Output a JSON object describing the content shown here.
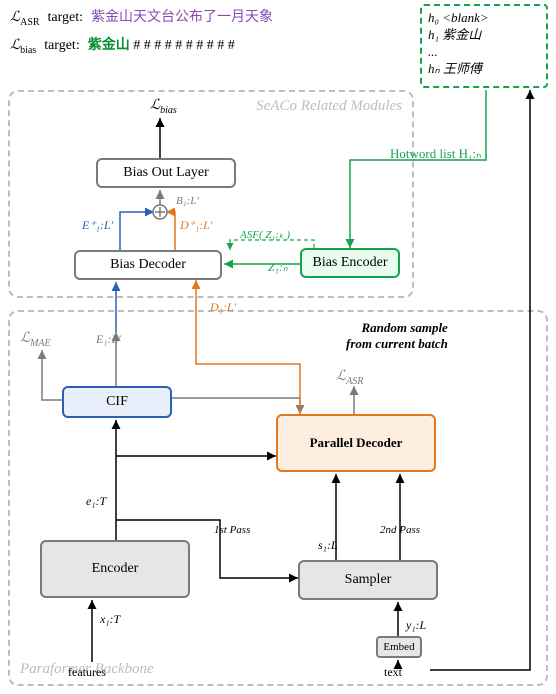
{
  "targets": {
    "asr": {
      "label": "ℒ",
      "sub": "ASR",
      "word": "target:",
      "value": "紫金山天文台公布了一月天象"
    },
    "bias": {
      "label": "ℒ",
      "sub": "bias",
      "word": "target:",
      "hot": "紫金山",
      "rest": "# # # # # # # # # #"
    }
  },
  "hotwords": {
    "h0": "h₀ <blank>",
    "h1": "h₁ 紫金山",
    "dots": "...",
    "hn": "hₙ 王师傅",
    "label": "Hotword list H₁:ₙ"
  },
  "seaco": {
    "label": "SeACo Related Modules"
  },
  "backbone": {
    "label": "Paraformer Backbone"
  },
  "blocks": {
    "bias_out": "Bias Out Layer",
    "bias_decoder": "Bias Decoder",
    "bias_encoder": "Bias Encoder",
    "cif": "CIF",
    "encoder": "Encoder",
    "parallel_decoder": "Parallel Decoder",
    "sampler": "Sampler",
    "embed": "Embed"
  },
  "losses": {
    "bias": {
      "sym": "ℒ",
      "sub": "bias"
    },
    "mae": {
      "sym": "ℒ",
      "sub": "MAE"
    },
    "asr": {
      "sym": "ℒ",
      "sub": "ASR"
    }
  },
  "edges": {
    "features": "features",
    "text": "text",
    "x1T": "x₁:T",
    "e1T": "e₁:T",
    "s1L": "s₁:L",
    "y1L": "y₁:L",
    "E1L": "E₁:L′",
    "D1L": "D₁:L′",
    "Eplus": "E⁺₁:L′",
    "Dplus": "D⁺₁:L′",
    "B1L": "B₁:L′",
    "Z1n": "Z₁:ₙ",
    "ASF": "ASF( Z₁:ₖ )",
    "pass1": "1st Pass",
    "pass2": "2nd Pass",
    "random": "Random sample\nfrom current batch"
  },
  "chart_data": {
    "type": "diagram",
    "nodes": [
      {
        "id": "features",
        "label": "features",
        "type": "input"
      },
      {
        "id": "text",
        "label": "text",
        "type": "input"
      },
      {
        "id": "encoder",
        "label": "Encoder",
        "type": "module"
      },
      {
        "id": "cif",
        "label": "CIF",
        "type": "module"
      },
      {
        "id": "embed",
        "label": "Embed",
        "type": "module"
      },
      {
        "id": "sampler",
        "label": "Sampler",
        "type": "module"
      },
      {
        "id": "parallel_decoder",
        "label": "Parallel Decoder",
        "type": "module"
      },
      {
        "id": "bias_encoder",
        "label": "Bias Encoder",
        "type": "module"
      },
      {
        "id": "bias_decoder",
        "label": "Bias Decoder",
        "type": "module"
      },
      {
        "id": "bias_out",
        "label": "Bias Out Layer",
        "type": "module"
      },
      {
        "id": "hotword_list",
        "label": "Hotword list H1:n",
        "type": "input"
      },
      {
        "id": "L_asr",
        "label": "L_ASR",
        "type": "loss"
      },
      {
        "id": "L_mae",
        "label": "L_MAE",
        "type": "loss"
      },
      {
        "id": "L_bias",
        "label": "L_bias",
        "type": "loss"
      }
    ],
    "edges": [
      {
        "from": "features",
        "to": "encoder",
        "label": "x1:T"
      },
      {
        "from": "encoder",
        "to": "cif",
        "label": "e1:T"
      },
      {
        "from": "encoder",
        "to": "parallel_decoder",
        "label": ""
      },
      {
        "from": "encoder",
        "to": "sampler",
        "label": ""
      },
      {
        "from": "text",
        "to": "embed",
        "label": ""
      },
      {
        "from": "embed",
        "to": "sampler",
        "label": "y1:L"
      },
      {
        "from": "sampler",
        "to": "parallel_decoder",
        "label": "s1:L / 1st Pass / 2nd Pass"
      },
      {
        "from": "cif",
        "to": "L_mae",
        "label": ""
      },
      {
        "from": "cif",
        "to": "parallel_decoder",
        "label": "E1:L'"
      },
      {
        "from": "cif",
        "to": "bias_decoder",
        "label": "E1:L'",
        "color": "blue"
      },
      {
        "from": "parallel_decoder",
        "to": "L_asr",
        "label": ""
      },
      {
        "from": "parallel_decoder",
        "to": "bias_decoder",
        "label": "D1:L'",
        "color": "orange"
      },
      {
        "from": "text",
        "to": "hotword_list",
        "label": "Random sample from current batch"
      },
      {
        "from": "hotword_list",
        "to": "bias_encoder",
        "label": "",
        "color": "green"
      },
      {
        "from": "bias_encoder",
        "to": "bias_decoder",
        "label": "Z1:n",
        "color": "green"
      },
      {
        "from": "bias_encoder",
        "to": "bias_decoder",
        "label": "ASF(Z1:k)",
        "style": "dashed",
        "color": "green"
      },
      {
        "from": "bias_decoder",
        "to": "bias_out",
        "label": "E+1:L' ⊕ D+1:L'"
      },
      {
        "from": "bias_out",
        "to": "L_bias",
        "label": "B1:L'"
      }
    ],
    "regions": [
      {
        "label": "SeACo Related Modules",
        "nodes": [
          "bias_encoder",
          "bias_decoder",
          "bias_out",
          "L_bias"
        ]
      },
      {
        "label": "Paraformer Backbone",
        "nodes": [
          "encoder",
          "cif",
          "parallel_decoder",
          "sampler",
          "embed",
          "L_mae",
          "L_asr"
        ]
      }
    ]
  }
}
